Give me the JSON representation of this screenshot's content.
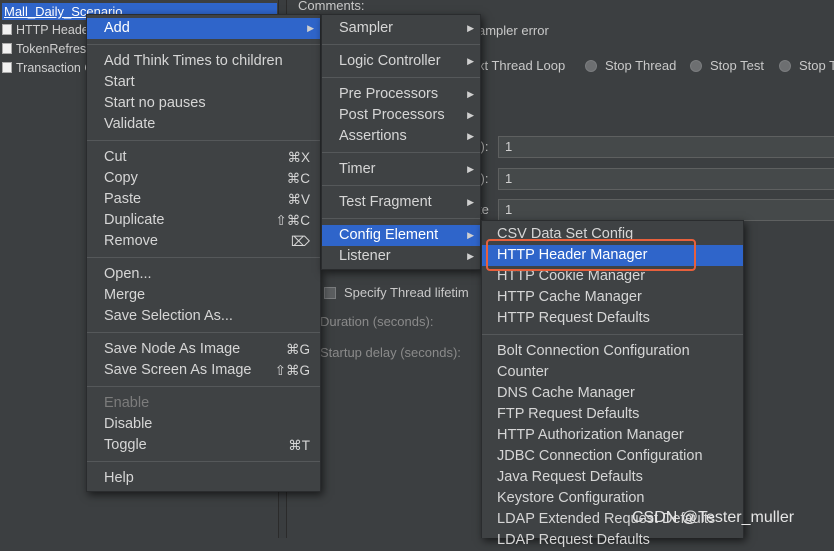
{
  "tree": {
    "root": "Mall_Daily_Scenario",
    "items": [
      "HTTP Header",
      "TokenRefresh",
      "Transaction C"
    ]
  },
  "right": {
    "comments_label": "Comments:",
    "sampler_error": "ampler error",
    "actions": [
      "xt Thread Loop",
      "Stop Thread",
      "Stop Test",
      "Stop T"
    ],
    "rows": [
      {
        "label": "s):",
        "value": "1"
      },
      {
        "label": "s):",
        "value": "1"
      },
      {
        "label": "te",
        "value": "1"
      }
    ],
    "specify_lifetime": "Specify Thread lifetim",
    "duration": "Duration (seconds):",
    "startup_delay": "Startup delay (seconds):"
  },
  "context_menu": {
    "add": "Add",
    "add_think_times": "Add Think Times to children",
    "start": "Start",
    "start_no_pauses": "Start no pauses",
    "validate": "Validate",
    "cut": {
      "label": "Cut",
      "shortcut": "⌘X"
    },
    "copy": {
      "label": "Copy",
      "shortcut": "⌘C"
    },
    "paste": {
      "label": "Paste",
      "shortcut": "⌘V"
    },
    "duplicate": {
      "label": "Duplicate",
      "shortcut": "⇧⌘C"
    },
    "remove": {
      "label": "Remove",
      "shortcut": "⌦"
    },
    "open": "Open...",
    "merge": "Merge",
    "save_selection": "Save Selection As...",
    "save_node_image": {
      "label": "Save Node As Image",
      "shortcut": "⌘G"
    },
    "save_screen_image": {
      "label": "Save Screen As Image",
      "shortcut": "⇧⌘G"
    },
    "enable": "Enable",
    "disable": "Disable",
    "toggle": {
      "label": "Toggle",
      "shortcut": "⌘T"
    },
    "help": "Help"
  },
  "add_menu": {
    "sampler": "Sampler",
    "logic_controller": "Logic Controller",
    "pre_processors": "Pre Processors",
    "post_processors": "Post Processors",
    "assertions": "Assertions",
    "timer": "Timer",
    "test_fragment": "Test Fragment",
    "config_element": "Config Element",
    "listener": "Listener"
  },
  "config_menu": {
    "group1": [
      "CSV Data Set Config",
      "HTTP Header Manager",
      "HTTP Cookie Manager",
      "HTTP Cache Manager",
      "HTTP Request Defaults"
    ],
    "group2": [
      "Bolt Connection Configuration",
      "Counter",
      "DNS Cache Manager",
      "FTP Request Defaults",
      "HTTP Authorization Manager",
      "JDBC Connection Configuration",
      "Java Request Defaults",
      "Keystore Configuration",
      "LDAP Extended Request Defaults",
      "LDAP Request Defaults"
    ]
  },
  "watermark": "CSDN @Tester_muller",
  "colors": {
    "selection": "#2f65ca",
    "highlight_box": "#e8603c",
    "menu_bg": "#3f4244"
  }
}
